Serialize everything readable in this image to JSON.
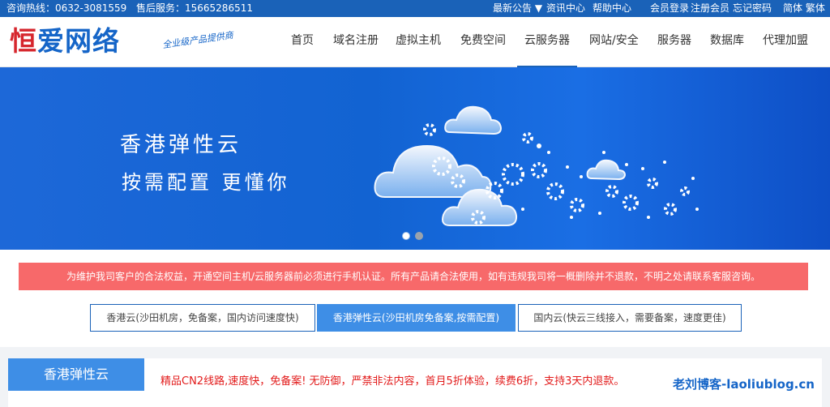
{
  "topbar": {
    "hotline": "咨询热线：0632-3081559",
    "aftersale": "售后服务：15665286511",
    "announcement": "最新公告",
    "news": "资讯中心",
    "help": "帮助中心",
    "login": "会员登录",
    "register": "注册会员",
    "forgot": "忘记密码",
    "lang": "简体 繁体"
  },
  "logo": {
    "brand_a": "恒",
    "brand_b": "爱网络",
    "tagline": "全业级产品提供商"
  },
  "nav": [
    "首页",
    "域名注册",
    "虚拟主机",
    "免费空间",
    "云服务器",
    "网站/安全",
    "服务器",
    "数据库",
    "代理加盟"
  ],
  "banner": {
    "title": "香港弹性云",
    "subtitle": "按需配置  更懂你"
  },
  "notice": "为维护我司客户的合法权益，开通空间主机/云服务器前必须进行手机认证。所有产品请合法使用，如有违规我司将一概删除并不退款，不明之处请联系客服咨询。",
  "tabs": [
    "香港云(沙田机房，免备案，国内访问速度快)",
    "香港弹性云(沙田机房免备案,按需配置)",
    "国内云(快云三线接入，需要备案，速度更佳)"
  ],
  "product": {
    "title": "香港弹性云",
    "promo": "精品CN2线路,速度快，免备案! 无防御，严禁非法内容，首月5折体验，续费6折，支持3天内退款。"
  },
  "watermark": "老刘博客-laoliublog.cn",
  "colors": {
    "topbar": "#1a62b8",
    "brand": "#1565c8",
    "notice": "#f7696a",
    "accent": "#3e8ee6",
    "promo": "#e21a1a"
  }
}
